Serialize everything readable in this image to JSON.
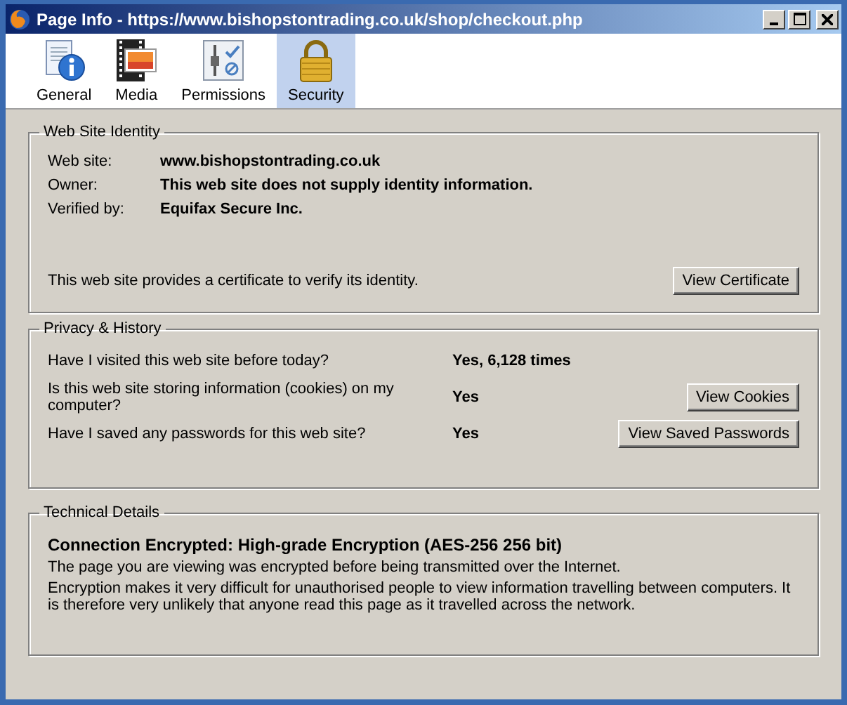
{
  "window": {
    "title": "Page Info - https://www.bishopstontrading.co.uk/shop/checkout.php"
  },
  "tabs": [
    {
      "label": "General",
      "kind": "general",
      "selected": false
    },
    {
      "label": "Media",
      "kind": "media",
      "selected": false
    },
    {
      "label": "Permissions",
      "kind": "permissions",
      "selected": false
    },
    {
      "label": "Security",
      "kind": "security",
      "selected": true
    }
  ],
  "identity": {
    "legend": "Web Site Identity",
    "rows": [
      {
        "label": "Web site:",
        "value": "www.bishopstontrading.co.uk"
      },
      {
        "label": "Owner:",
        "value": "This web site does not supply identity information."
      },
      {
        "label": "Verified by:",
        "value": "Equifax Secure Inc."
      }
    ],
    "note": "This web site provides a certificate to verify its identity.",
    "button": "View Certificate"
  },
  "privacy": {
    "legend": "Privacy & History",
    "rows": [
      {
        "question": "Have I visited this web site before today?",
        "answer": "Yes, 6,128 times"
      },
      {
        "question": "Is this web site storing information (cookies) on my computer?",
        "answer": "Yes",
        "button": "View Cookies"
      },
      {
        "question": "Have I saved any passwords for this web site?",
        "answer": "Yes",
        "button": "View Saved Passwords"
      }
    ]
  },
  "technical": {
    "legend": "Technical Details",
    "heading": "Connection Encrypted: High-grade Encryption (AES-256 256 bit)",
    "paragraphs": [
      "The page you are viewing was encrypted before being transmitted over the Internet.",
      "Encryption makes it very difficult for unauthorised people to view information travelling between computers. It is therefore very unlikely that anyone read this page as it travelled across the network."
    ]
  }
}
